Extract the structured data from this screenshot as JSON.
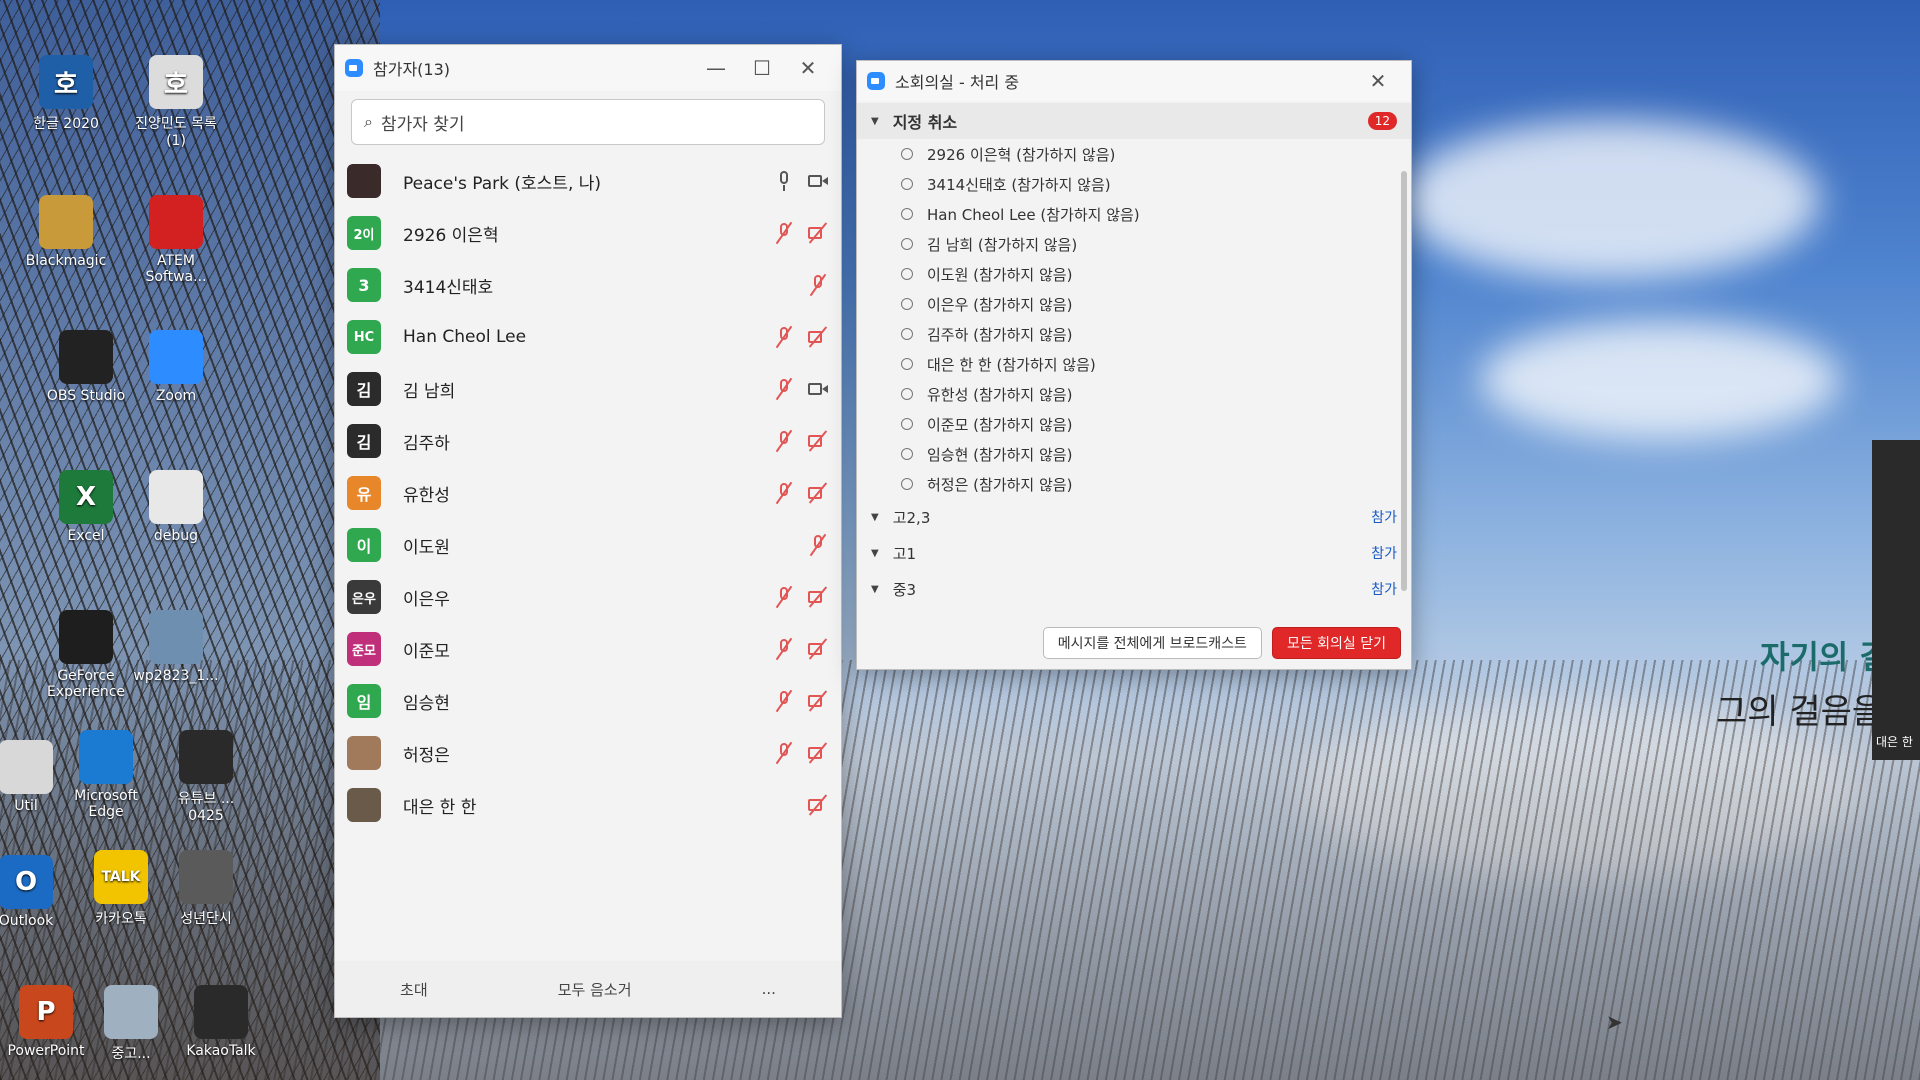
{
  "desktop": {
    "icons": [
      {
        "label": "한글 2020",
        "glyph": "호",
        "color": "#1f5fa8"
      },
      {
        "label": "진양민도 목록 (1)",
        "glyph": "호",
        "color": "#dcdcdc"
      },
      {
        "label": "Blackmagic",
        "glyph": "",
        "color": "#c99a3a"
      },
      {
        "label": "ATEM Softwa...",
        "glyph": "",
        "color": "#d32020"
      },
      {
        "label": "OBS Studio",
        "glyph": "",
        "color": "#222222"
      },
      {
        "label": "Zoom",
        "glyph": "",
        "color": "#2d8cff"
      },
      {
        "label": "Excel",
        "glyph": "X",
        "color": "#1d7a3a"
      },
      {
        "label": "debug",
        "glyph": "",
        "color": "#e8e8e8"
      },
      {
        "label": "GeForce Experience",
        "glyph": "",
        "color": "#1e1e1e"
      },
      {
        "label": "wp2823_1...",
        "glyph": "",
        "color": "#6f8fb0"
      },
      {
        "label": "Microsoft Edge",
        "glyph": "",
        "color": "#1b7bd2"
      },
      {
        "label": "유튜브 ... 0425",
        "glyph": "",
        "color": "#2a2a2a"
      },
      {
        "label": "카카오톡",
        "glyph": "TALK",
        "color": "#f2c400"
      },
      {
        "label": "성년단시",
        "glyph": "",
        "color": "#5a5a5a"
      },
      {
        "label": "PowerPoint",
        "glyph": "P",
        "color": "#c9471c"
      },
      {
        "label": "중고...",
        "glyph": "",
        "color": "#9fb0c0"
      },
      {
        "label": "KakaoTalk",
        "glyph": "",
        "color": "#2a2a2a"
      },
      {
        "label": "Util",
        "glyph": "",
        "color": "#d8d8d8"
      },
      {
        "label": "Outlook",
        "glyph": "O",
        "color": "#1b6bc4"
      }
    ]
  },
  "participants": {
    "title": "참가자(13)",
    "search_placeholder": "참가자 찾기",
    "list": [
      {
        "name": "Peace's Park (호스트, 나)",
        "avatar": "",
        "avatar_color": "#3b2a2a",
        "mic": "on",
        "cam": "on"
      },
      {
        "name": "2926 이은혁",
        "avatar": "2이",
        "avatar_color": "#2fa84f",
        "mic": "off",
        "cam": "off"
      },
      {
        "name": "3414신태호",
        "avatar": "3",
        "avatar_color": "#2fa84f",
        "mic": "off",
        "cam": "none"
      },
      {
        "name": "Han Cheol Lee",
        "avatar": "HC",
        "avatar_color": "#2fa84f",
        "mic": "off",
        "cam": "off"
      },
      {
        "name": "김 남희",
        "avatar": "김",
        "avatar_color": "#2b2b2b",
        "mic": "off",
        "cam": "on"
      },
      {
        "name": "김주하",
        "avatar": "김",
        "avatar_color": "#2b2b2b",
        "mic": "off",
        "cam": "off"
      },
      {
        "name": "유한성",
        "avatar": "유",
        "avatar_color": "#e8862a",
        "mic": "off",
        "cam": "off"
      },
      {
        "name": "이도원",
        "avatar": "이",
        "avatar_color": "#2fa84f",
        "mic": "off",
        "cam": "none"
      },
      {
        "name": "이은우",
        "avatar": "은우",
        "avatar_color": "#3a3a3a",
        "mic": "off",
        "cam": "off"
      },
      {
        "name": "이준모",
        "avatar": "준모",
        "avatar_color": "#c0307a",
        "mic": "off",
        "cam": "off"
      },
      {
        "name": "임승현",
        "avatar": "임",
        "avatar_color": "#2fa84f",
        "mic": "off",
        "cam": "off"
      },
      {
        "name": "허정은",
        "avatar": "",
        "avatar_color": "#a07a5a",
        "mic": "off",
        "cam": "off"
      },
      {
        "name": "대은 한 한",
        "avatar": "",
        "avatar_color": "#6a5a4a",
        "mic": "none",
        "cam": "off"
      }
    ],
    "footer": {
      "invite": "초대",
      "mute_all": "모두 음소거",
      "more": "..."
    }
  },
  "breakout": {
    "title": "소회의실 - 처리 중",
    "unassigned": {
      "label": "지정 취소",
      "count": "12",
      "members": [
        "2926 이은혁 (참가하지 않음)",
        "3414신태호 (참가하지 않음)",
        "Han Cheol Lee (참가하지 않음)",
        "김 남희 (참가하지 않음)",
        "이도원 (참가하지 않음)",
        "이은우 (참가하지 않음)",
        "김주하 (참가하지 않음)",
        "대은 한 한 (참가하지 않음)",
        "유한성 (참가하지 않음)",
        "이준모 (참가하지 않음)",
        "임승현 (참가하지 않음)",
        "허정은 (참가하지 않음)"
      ]
    },
    "rooms": [
      {
        "name": "고2,3",
        "join": "참가"
      },
      {
        "name": "고1",
        "join": "참가"
      },
      {
        "name": "중3",
        "join": "참가"
      }
    ],
    "broadcast_label": "메시지를 전체에게 브로드캐스트",
    "close_all_label": "모든 회의실 닫기"
  },
  "slide": {
    "line1": "자기의 길",
    "line2": "그의 걸음을",
    "tag": "대은 한"
  }
}
